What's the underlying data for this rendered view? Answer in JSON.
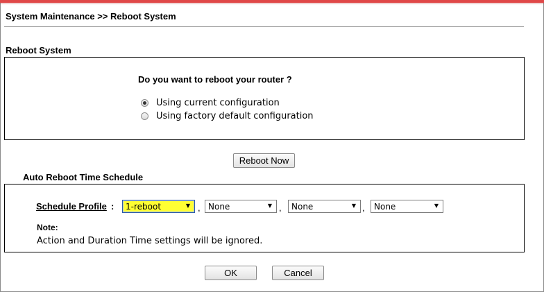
{
  "breadcrumb": "System Maintenance >> Reboot System",
  "reboot_section": {
    "label": "Reboot System",
    "question": "Do you want to reboot your router ?",
    "options": [
      {
        "label": "Using current configuration",
        "checked": true
      },
      {
        "label": "Using factory default configuration",
        "checked": false
      }
    ],
    "reboot_button": "Reboot Now"
  },
  "auto_reboot_section": {
    "label": "Auto Reboot Time Schedule",
    "profile_label": "Schedule Profile",
    "colon": ":",
    "separator": ",",
    "profiles": [
      "1-reboot",
      "None",
      "None",
      "None"
    ],
    "dropdown_arrow": "▼",
    "note_label": "Note:",
    "note_text": "Action and Duration Time settings will be ignored."
  },
  "footer": {
    "ok_label": "OK",
    "cancel_label": "Cancel"
  },
  "colors": {
    "accent_bar": "#e04848",
    "highlight_select": "#ffff33",
    "border": "#000000"
  }
}
